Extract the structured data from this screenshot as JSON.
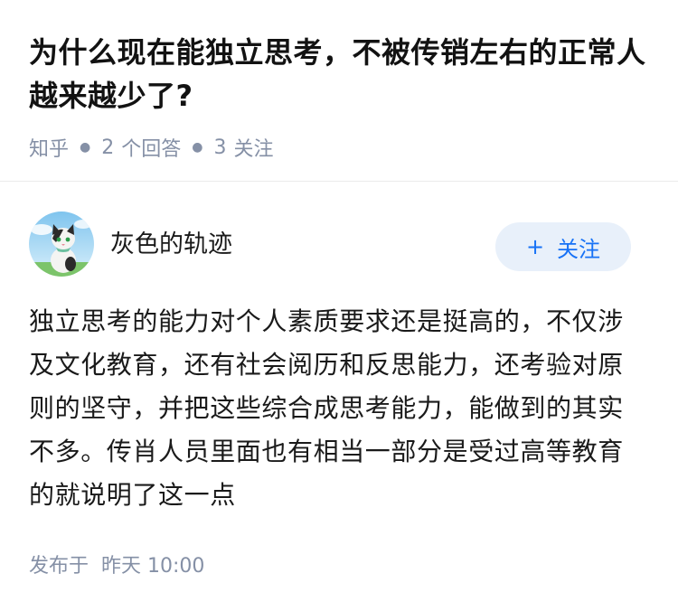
{
  "question": {
    "title": "为什么现在能独立思考，不被传销左右的正常人越来越少了?",
    "source": "知乎",
    "answer_count": "2",
    "answer_label": "个回答",
    "follower_count": "3",
    "follower_label": "关注"
  },
  "answer": {
    "author_name": "灰色的轨迹",
    "follow_plus": "+",
    "follow_label": "关注",
    "content": "独立思考的能力对个人素质要求还是挺高的，不仅涉及文化教育，还有社会阅历和反思能力，还考验对原则的坚守，并把这些综合成思考能力，能做到的其实不多。传肖人员里面也有相当一部分是受过高等教育的就说明了这一点",
    "published_label": "发布于",
    "published_time": "昨天 10:00"
  },
  "colors": {
    "meta_gray": "#8590a6",
    "accent_blue": "#1772f6",
    "follow_bg": "#e8f0fa"
  },
  "icons": {
    "avatar": "cartoon-cat-avatar"
  }
}
